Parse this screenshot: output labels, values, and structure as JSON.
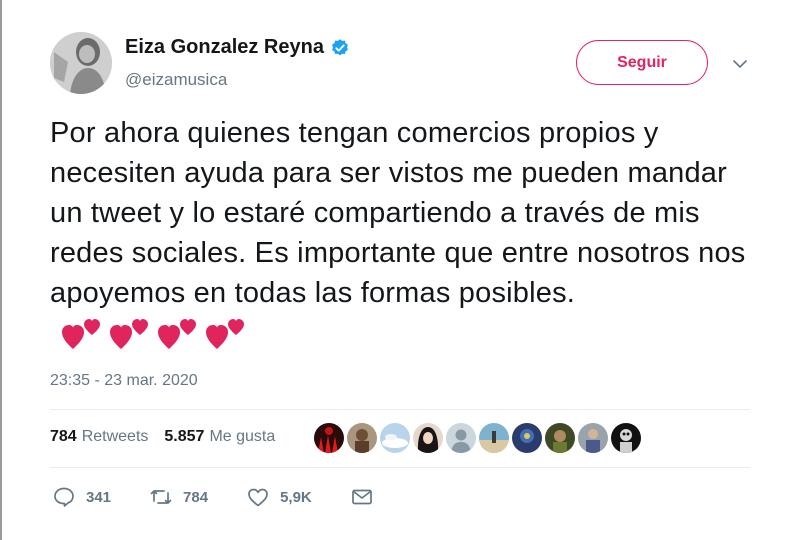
{
  "user": {
    "name": "Eiza Gonzalez Reyna",
    "handle": "@eizamusica",
    "verified": true
  },
  "follow_button": {
    "label": "Seguir"
  },
  "tweet": {
    "text": "Por ahora quienes tengan comercios propios y necesiten ayuda para ser vistos me pueden mandar un tweet y lo estaré compartiendo a través de mis redes sociales. Es importante que entre nosotros nos apoyemos en todas las formas posibles.",
    "emoji": [
      "two-hearts",
      "two-hearts",
      "two-hearts",
      "two-hearts"
    ],
    "timestamp": "23:35 - 23 mar. 2020"
  },
  "stats": {
    "retweets_count": "784",
    "retweets_label": "Retweets",
    "likes_count": "5.857",
    "likes_label": "Me gusta"
  },
  "likers": [
    {
      "icon": "avatar-red"
    },
    {
      "icon": "avatar-brown"
    },
    {
      "icon": "avatar-sky"
    },
    {
      "icon": "avatar-dark-hair"
    },
    {
      "icon": "avatar-default"
    },
    {
      "icon": "avatar-beach"
    },
    {
      "icon": "avatar-blue"
    },
    {
      "icon": "avatar-green"
    },
    {
      "icon": "avatar-gray"
    },
    {
      "icon": "avatar-black"
    }
  ],
  "actions": {
    "reply_count": "341",
    "retweet_count": "784",
    "like_count": "5,9K"
  },
  "colors": {
    "accent": "#e0245e",
    "verified": "#1da1f2",
    "muted": "#657786",
    "text": "#14171a",
    "divider": "#e6ecf0"
  }
}
